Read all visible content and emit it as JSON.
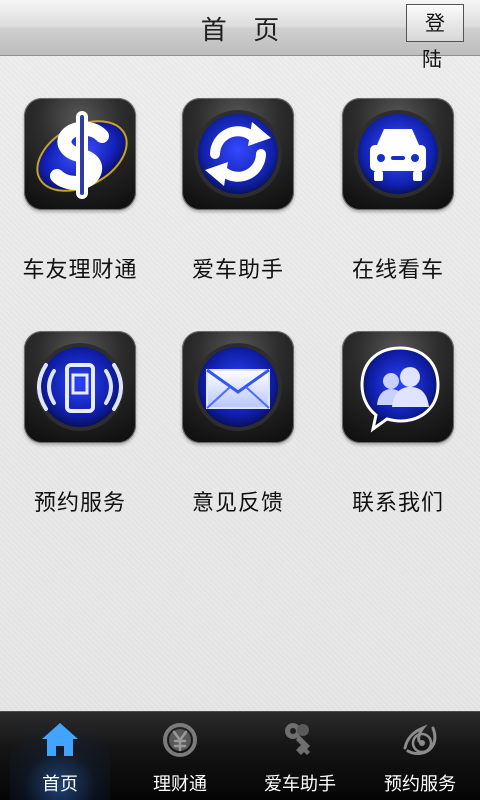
{
  "header": {
    "title": "首 页",
    "login_label": "登陆"
  },
  "menu": {
    "items": [
      {
        "label": "车友理财通",
        "icon": "dollar-icon"
      },
      {
        "label": "爱车助手",
        "icon": "refresh-icon"
      },
      {
        "label": "在线看车",
        "icon": "car-icon"
      },
      {
        "label": "预约服务",
        "icon": "phone-signal-icon"
      },
      {
        "label": "意见反馈",
        "icon": "mail-icon"
      },
      {
        "label": "联系我们",
        "icon": "contacts-icon"
      }
    ]
  },
  "tabbar": {
    "items": [
      {
        "label": "首页",
        "icon": "home-icon"
      },
      {
        "label": "理财通",
        "icon": "yen-icon"
      },
      {
        "label": "爱车助手",
        "icon": "key-icon"
      },
      {
        "label": "预约服务",
        "icon": "service-icon"
      }
    ],
    "active_index": 0
  },
  "colors": {
    "accent": "#1a3dff",
    "tab_active": "#2f7fff",
    "tab_bg": "#111111"
  }
}
